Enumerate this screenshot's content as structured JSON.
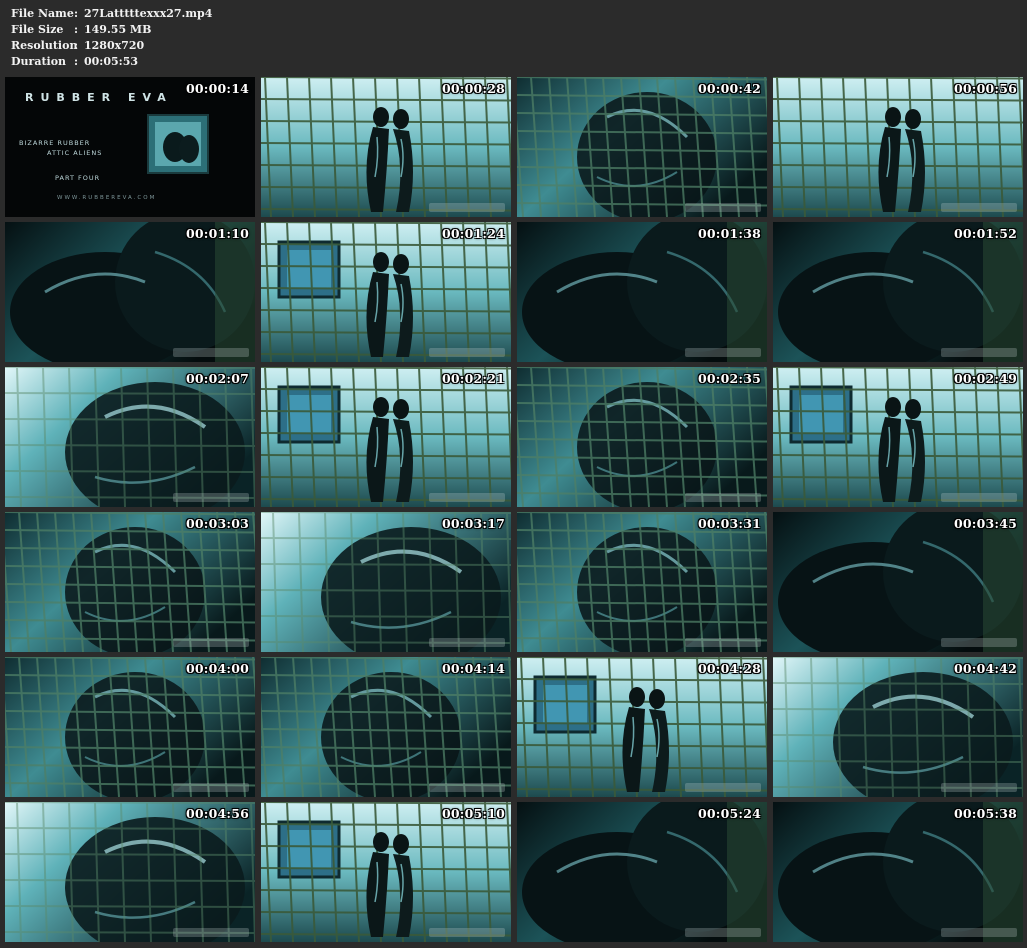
{
  "file_info": {
    "name_label": "File Name",
    "name_value": "27Latttttexxx27.mp4",
    "size_label": "File Size",
    "size_value": "149.55 MB",
    "resolution_label": "Resolution",
    "resolution_value": "1280x720",
    "duration_label": "Duration",
    "duration_value": "00:05:53",
    "separator": ":"
  },
  "thumbnails": [
    {
      "time": "00:00:14",
      "scene": "title"
    },
    {
      "time": "00:00:28",
      "scene": "cage-wide"
    },
    {
      "time": "00:00:42",
      "scene": "closeup-cage"
    },
    {
      "time": "00:00:56",
      "scene": "cage-wide"
    },
    {
      "time": "00:01:10",
      "scene": "closeup-dark"
    },
    {
      "time": "00:01:24",
      "scene": "pair-window"
    },
    {
      "time": "00:01:38",
      "scene": "closeup-dark"
    },
    {
      "time": "00:01:52",
      "scene": "closeup-dark"
    },
    {
      "time": "00:02:07",
      "scene": "closeup-light"
    },
    {
      "time": "00:02:21",
      "scene": "pair-window"
    },
    {
      "time": "00:02:35",
      "scene": "closeup-cage"
    },
    {
      "time": "00:02:49",
      "scene": "pair-window"
    },
    {
      "time": "00:03:03",
      "scene": "closeup-cage"
    },
    {
      "time": "00:03:17",
      "scene": "closeup-light"
    },
    {
      "time": "00:03:31",
      "scene": "closeup-cage"
    },
    {
      "time": "00:03:45",
      "scene": "closeup-dark"
    },
    {
      "time": "00:04:00",
      "scene": "closeup-cage"
    },
    {
      "time": "00:04:14",
      "scene": "closeup-cage"
    },
    {
      "time": "00:04:28",
      "scene": "pair-window"
    },
    {
      "time": "00:04:42",
      "scene": "closeup-light"
    },
    {
      "time": "00:04:56",
      "scene": "closeup-light"
    },
    {
      "time": "00:05:10",
      "scene": "pair-window"
    },
    {
      "time": "00:05:24",
      "scene": "closeup-dark"
    },
    {
      "time": "00:05:38",
      "scene": "closeup-dark"
    }
  ],
  "title_card": {
    "logo_text": "RUBBER EVA",
    "subtitle_line1": "BIZARRE RUBBER",
    "subtitle_line2": "ATTIC ALIENS",
    "part_text": "PART FOUR",
    "site_text": "WWW.RUBBEREVA.COM"
  },
  "colors": {
    "background": "#2b2b2b",
    "text": "#f2f2f2",
    "teal_dark": "#0a2a2e",
    "teal_mid": "#1f6d73",
    "teal_light": "#7fd6dc",
    "cage_green": "#3a5a3a"
  }
}
